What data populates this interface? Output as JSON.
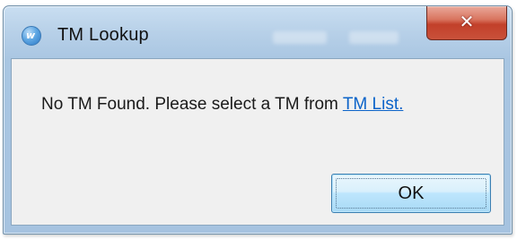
{
  "window": {
    "title": "TM Lookup",
    "app_icon": "w-logo-icon",
    "close_glyph": "✕"
  },
  "dialog": {
    "message_text": "No TM Found. Please select a TM from ",
    "link_text": "TM List.",
    "ok_label": "OK"
  },
  "colors": {
    "titlebar": "#b7d0e8",
    "client_bg": "#f0f0f0",
    "link": "#0b63c9",
    "close_button": "#c2402a",
    "ok_button": "#bee6fd"
  }
}
